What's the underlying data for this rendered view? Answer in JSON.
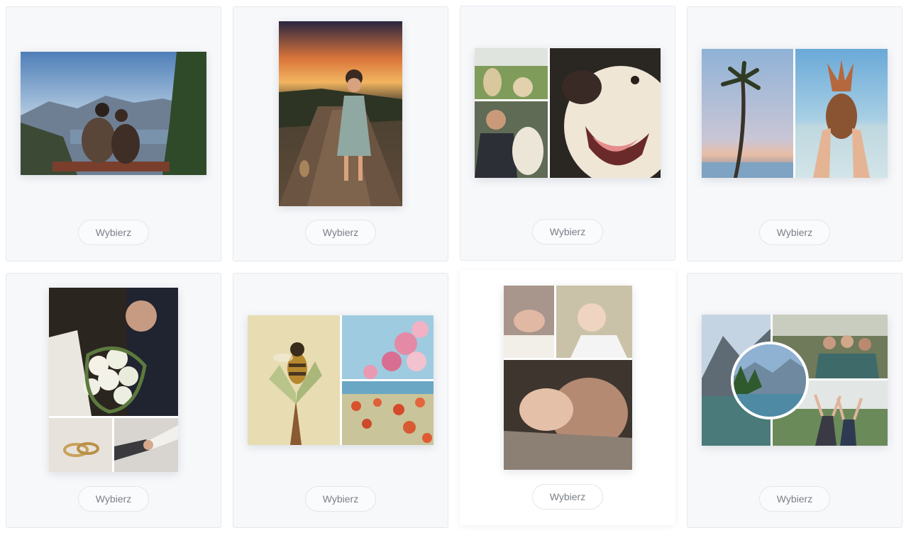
{
  "button_label": "Wybierz",
  "templates": [
    {
      "name": "couple-on-bench",
      "photos": [
        "couple-mountain-view"
      ]
    },
    {
      "name": "girl-sunset",
      "photos": [
        "girl-on-road"
      ]
    },
    {
      "name": "dogs-collage",
      "photos": [
        "two-dogs-field",
        "man-with-dog",
        "dog-closeup"
      ]
    },
    {
      "name": "tropical-duo",
      "photos": [
        "palm-tree-beach",
        "hands-holding-pineapple"
      ]
    },
    {
      "name": "wedding-collage",
      "photos": [
        "bride-groom-bouquet",
        "wedding-rings",
        "holding-hands"
      ]
    },
    {
      "name": "spring-collage",
      "photos": [
        "bee-on-bud",
        "pink-blossoms",
        "red-poppies"
      ]
    },
    {
      "name": "baby-collage",
      "photos": [
        "baby-feet",
        "baby-on-fur",
        "father-with-newborn"
      ]
    },
    {
      "name": "travel-collage",
      "photos": [
        "mountain-lake",
        "friends-group",
        "forest-lake-circle",
        "hikers-cheering"
      ]
    }
  ],
  "colors": {
    "card_bg": "#f7f8fa",
    "active_card_bg": "#ffffff",
    "button_text": "#7a7f88"
  }
}
